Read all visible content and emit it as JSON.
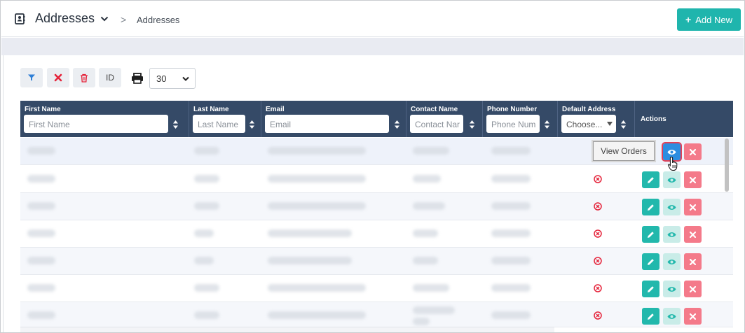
{
  "header": {
    "title": "Addresses",
    "breadcrumb_sep": ">",
    "breadcrumb": "Addresses",
    "add_button": "Add New"
  },
  "toolbar": {
    "id_label": "ID",
    "page_size": "30"
  },
  "table": {
    "columns": {
      "first_name": {
        "label": "First Name",
        "placeholder": "First Name"
      },
      "last_name": {
        "label": "Last Name",
        "placeholder": "Last Name"
      },
      "email": {
        "label": "Email",
        "placeholder": "Email"
      },
      "contact_name": {
        "label": "Contact Name",
        "placeholder": "Contact Nar"
      },
      "phone": {
        "label": "Phone Number",
        "placeholder": "Phone Num"
      },
      "default_address": {
        "label": "Default Address",
        "placeholder": "Choose..."
      },
      "actions": {
        "label": "Actions"
      }
    }
  },
  "tooltip": "View Orders",
  "colors": {
    "accent": "#1fb5ad",
    "header_bg": "#354a67",
    "danger": "#e5243b",
    "view_active": "#2c8de0"
  }
}
